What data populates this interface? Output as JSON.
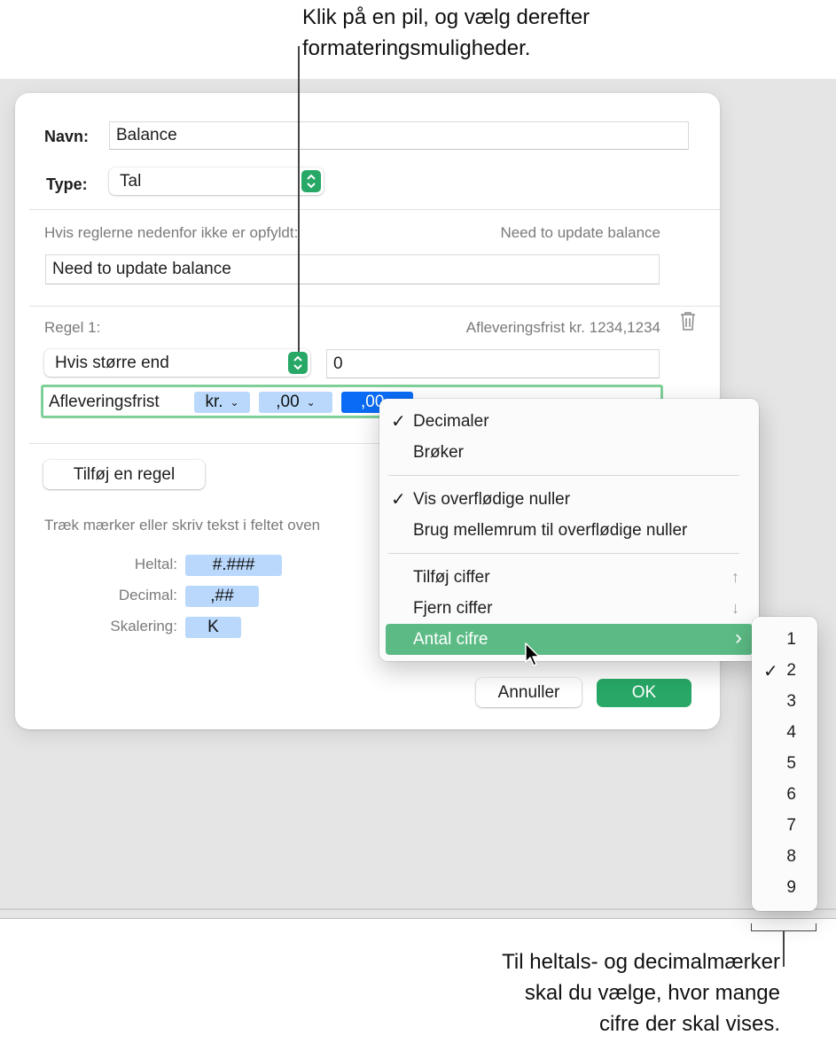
{
  "callouts": {
    "top_line1": "Klik på en pil, og vælg derefter",
    "top_line2": "formateringsmuligheder.",
    "bottom_line1": "Til heltals- og decimalmærker",
    "bottom_line2": "skal du vælge, hvor mange",
    "bottom_line3": "cifre der skal vises."
  },
  "dialog": {
    "name_label": "Navn:",
    "name_value": "Balance",
    "type_label": "Type:",
    "type_value": "Tal",
    "fallback_label": "Hvis reglerne nedenfor ikke er opfyldt:",
    "fallback_preview": "Need to update balance",
    "fallback_value": "Need to update balance",
    "rule_label": "Regel 1:",
    "rule_preview": "Afleveringsfrist kr. 1234,1234",
    "condition_value": "Hvis større end",
    "condition_number": "0",
    "format_text": "Afleveringsfrist",
    "token_currency": "kr.",
    "token_decimals": ",00",
    "token_extra": ",00",
    "add_rule_button": "Tilføj en regel",
    "hint": "Træk mærker eller skriv tekst i feltet oven",
    "tokens": {
      "integer_label": "Heltal:",
      "integer_token": "#.###",
      "decimal_label": "Decimal:",
      "decimal_token": ",##",
      "scale_label": "Skalering:",
      "scale_token": "K"
    },
    "cancel_button": "Annuller",
    "ok_button": "OK"
  },
  "menu": {
    "items": [
      {
        "label": "Decimaler",
        "checked": true
      },
      {
        "label": "Brøker",
        "checked": false
      },
      {
        "label": "Vis overflødige nuller",
        "checked": true
      },
      {
        "label": "Brug mellemrum til overflødige nuller",
        "checked": false
      },
      {
        "label": "Tilføj ciffer",
        "shortcut": "↑"
      },
      {
        "label": "Fjern ciffer",
        "shortcut": "↓"
      },
      {
        "label": "Antal cifre",
        "submenu_arrow": "›",
        "highlighted": true
      }
    ],
    "checkmark": "✓"
  },
  "submenu": {
    "items": [
      "1",
      "2",
      "3",
      "4",
      "5",
      "6",
      "7",
      "8",
      "9"
    ],
    "selected": "2"
  },
  "colors": {
    "accent_green": "#27a866",
    "highlight_green": "#5cbb85",
    "token_blue": "#b9d8fb",
    "token_selected": "#0a6cf5",
    "focus_ring": "#7fcf99"
  },
  "icons": {
    "stepper": "up-down-chevron-icon",
    "trash": "trash-icon",
    "cursor": "arrow-pointer-icon"
  }
}
